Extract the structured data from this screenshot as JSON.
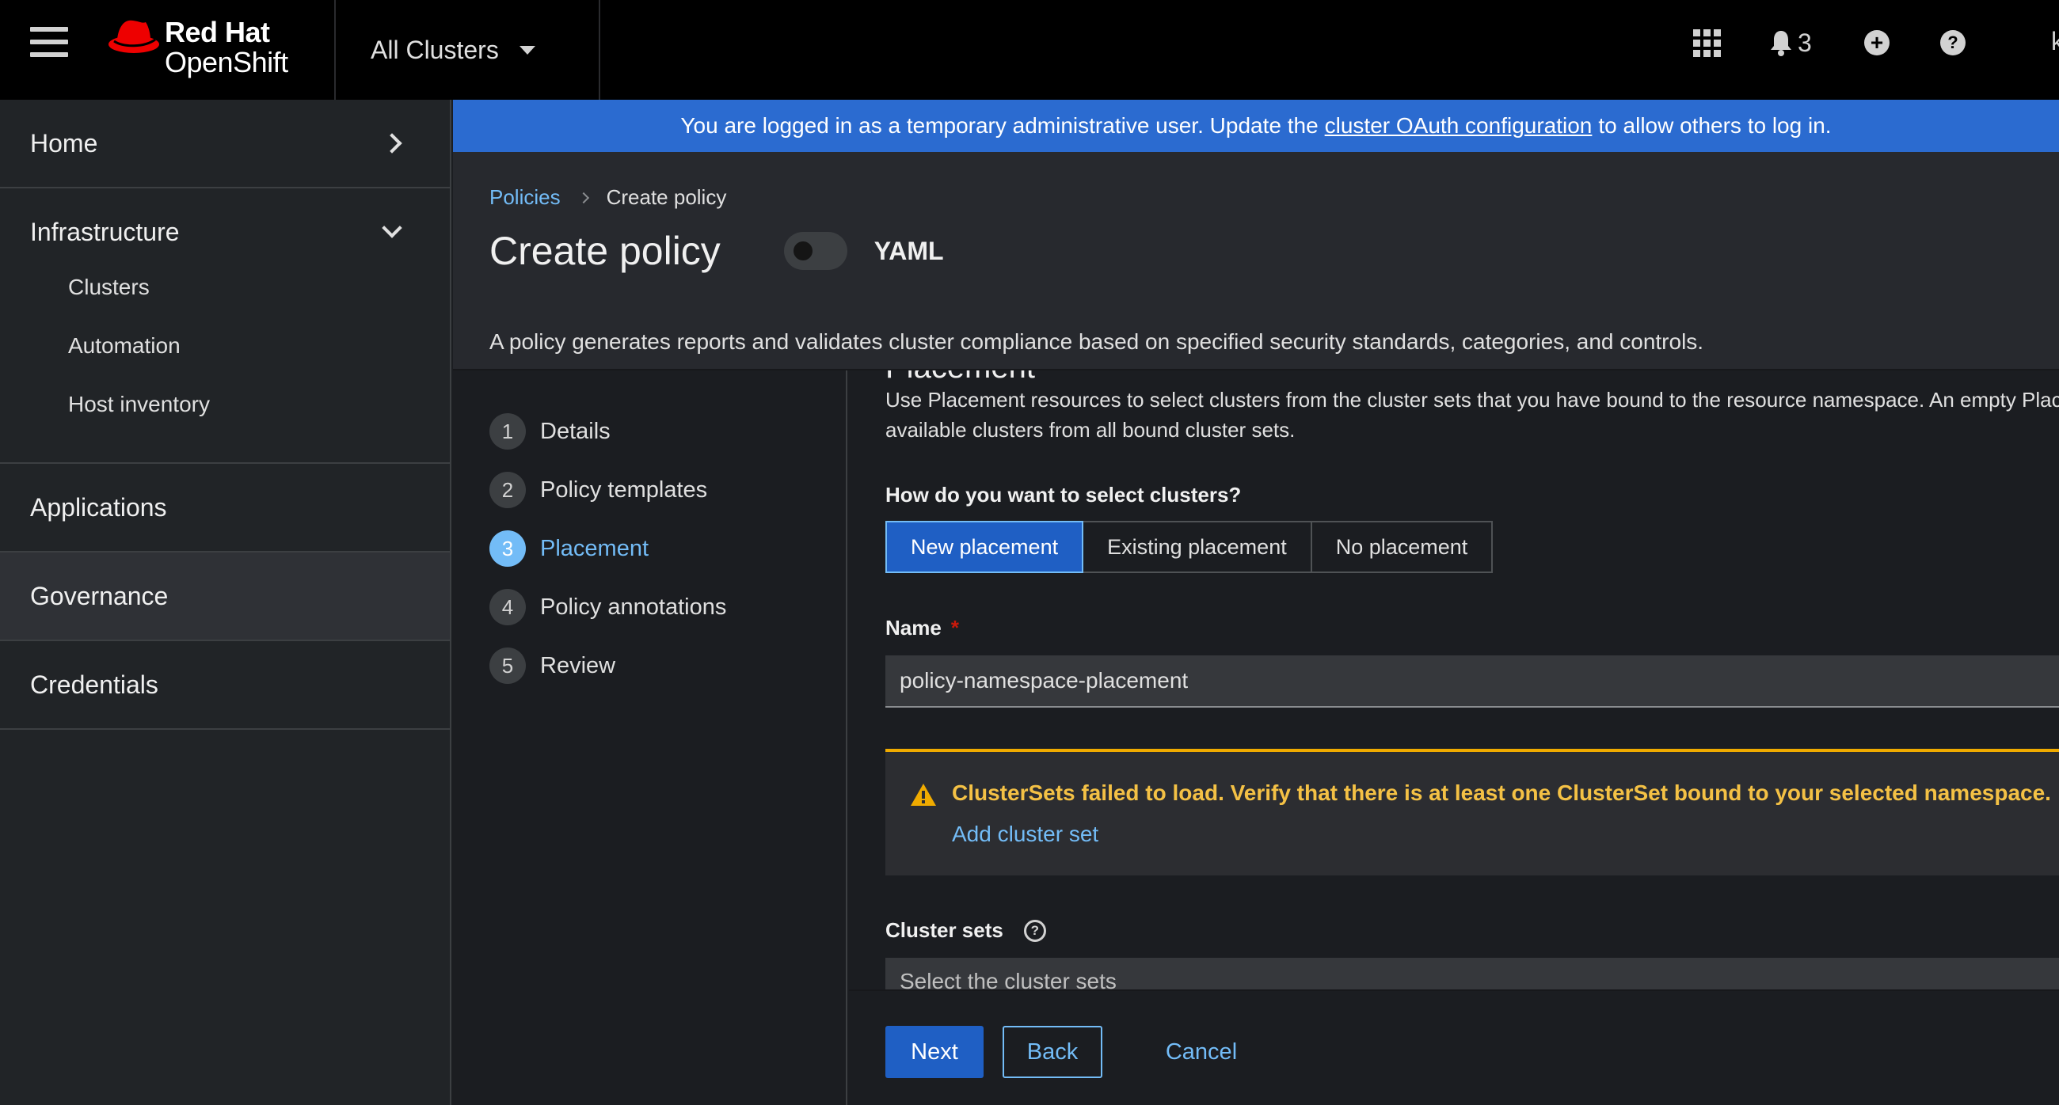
{
  "masthead": {
    "brand_line1": "Red Hat",
    "brand_line2": "OpenShift",
    "cluster_switcher": "All Clusters",
    "notification_count": "3",
    "user_initial": "k"
  },
  "sidebar": {
    "sections": [
      {
        "label": "Home",
        "state": "collapsed"
      },
      {
        "label": "Infrastructure",
        "state": "expanded",
        "items": [
          "Clusters",
          "Automation",
          "Host inventory"
        ]
      },
      {
        "label": "Applications"
      },
      {
        "label": "Governance",
        "current": true
      },
      {
        "label": "Credentials"
      }
    ]
  },
  "banner": {
    "text_before": "You are logged in as a temporary administrative user. Update the",
    "link": "cluster OAuth configuration",
    "text_after": "to allow others to log in."
  },
  "header": {
    "breadcrumb_link": "Policies",
    "breadcrumb_current": "Create policy",
    "title": "Create policy",
    "toggle_label": "YAML",
    "description": "A policy generates reports and validates cluster compliance based on specified security standards, categories, and controls."
  },
  "wizard": {
    "steps": [
      {
        "num": "1",
        "label": "Details"
      },
      {
        "num": "2",
        "label": "Policy templates"
      },
      {
        "num": "3",
        "label": "Placement",
        "active": true
      },
      {
        "num": "4",
        "label": "Policy annotations"
      },
      {
        "num": "5",
        "label": "Review"
      }
    ],
    "section_title": "Placement",
    "section_desc_line1": "Use Placement resources to select clusters from the cluster sets that you have bound to the resource namespace. An empty Placement",
    "section_desc_line2": "available clusters from all bound cluster sets.",
    "question": "How do you want to select clusters?",
    "placement_options": [
      "New placement",
      "Existing placement",
      "No placement"
    ],
    "selected_option": "New placement",
    "name_label": "Name",
    "name_required": "*",
    "name_value": "policy-namespace-placement",
    "alert_title": "ClusterSets failed to load. Verify that there is at least one ClusterSet bound to your selected namespace.",
    "alert_link": "Add cluster set",
    "cluster_sets_label": "Cluster sets",
    "cluster_sets_placeholder": "Select the cluster sets",
    "footer": {
      "next": "Next",
      "back": "Back",
      "cancel": "Cancel"
    }
  },
  "colors": {
    "accent": "#1f5fc4",
    "link": "#73bcf7",
    "banner": "#2b6bd0",
    "warning": "#f0ab00",
    "brand_red": "#ee0000"
  }
}
